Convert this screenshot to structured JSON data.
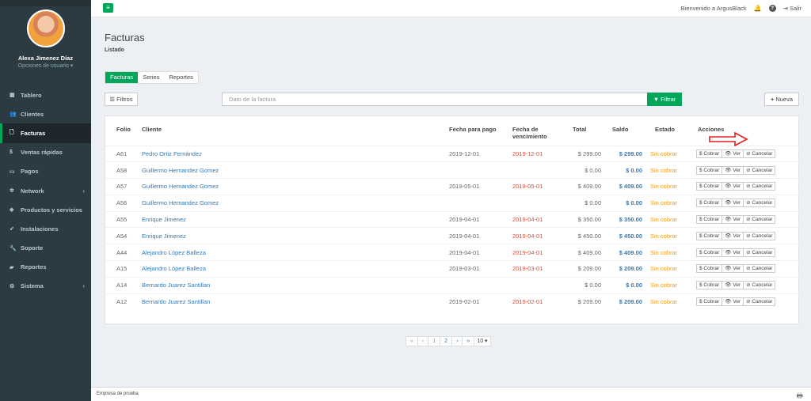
{
  "sidebar": {
    "user_name": "Alexa Jimenez Díaz",
    "user_options": "Opciones de usuario ▾",
    "items": [
      {
        "icon": "dashboard-icon",
        "glyph": "▦",
        "label": "Tablero",
        "active": false
      },
      {
        "icon": "users-icon",
        "glyph": "👥",
        "label": "Clientes",
        "active": false
      },
      {
        "icon": "file-icon",
        "glyph": "🗋",
        "label": "Facturas",
        "active": true
      },
      {
        "icon": "dollar-icon",
        "glyph": "$",
        "label": "Ventas rápidas",
        "active": false
      },
      {
        "icon": "card-icon",
        "glyph": "▭",
        "label": "Pagos",
        "active": false
      },
      {
        "icon": "network-icon",
        "glyph": "✲",
        "label": "Network",
        "active": false,
        "caret": "‹"
      },
      {
        "icon": "tag-icon",
        "glyph": "◈",
        "label": "Productos y servicios",
        "active": false
      },
      {
        "icon": "rocket-icon",
        "glyph": "➶",
        "label": "Instalaciones",
        "active": false
      },
      {
        "icon": "wrench-icon",
        "glyph": "🔧",
        "label": "Soporte",
        "active": false
      },
      {
        "icon": "book-icon",
        "glyph": "▰",
        "label": "Reportes",
        "active": false
      },
      {
        "icon": "cogs-icon",
        "glyph": "⚙",
        "label": "Sistema",
        "active": false,
        "caret": "‹"
      }
    ]
  },
  "topbar": {
    "menu_glyph": "≡",
    "welcome": "Bienvenido a ArgusBlack",
    "bell_glyph": "🔔",
    "help_glyph": "?",
    "logout_label": "Salir"
  },
  "page": {
    "title": "Facturas",
    "subtitle": "Listado"
  },
  "tabs": [
    "Facturas",
    "Series",
    "Reportes"
  ],
  "toolbar": {
    "filters_label": "Filtros",
    "search_placeholder": "Dato de la factura",
    "filter_button": "Filtrar",
    "new_button": "Nueva"
  },
  "table": {
    "headers": {
      "folio": "Folio",
      "client": "Cliente",
      "payment_date": "Fecha para pago",
      "due_date": "Fecha de vencimiento",
      "total": "Total",
      "balance": "Saldo",
      "status": "Estado",
      "actions": "Acciones"
    },
    "action_labels": {
      "charge": "$ Cobrar",
      "view": "👁 Ver",
      "cancel": "⊘ Cancelar"
    },
    "rows": [
      {
        "folio": "A61",
        "client": "Pedro Ortiz Fernández",
        "payment_date": "2019-12-01",
        "due_date": "2019-12-01",
        "total": "$ 299.00",
        "balance": "$ 299.00",
        "status": "Sin cobrar"
      },
      {
        "folio": "A58",
        "client": "Guillermo Hernandez Gomez",
        "payment_date": "",
        "due_date": "",
        "total": "$ 0.00",
        "balance": "$ 0.00",
        "status": "Sin cobrar"
      },
      {
        "folio": "A57",
        "client": "Guillermo Hernandez Gomez",
        "payment_date": "2019-05-01",
        "due_date": "2019-05-01",
        "total": "$ 409.00",
        "balance": "$ 409.00",
        "status": "Sin cobrar"
      },
      {
        "folio": "A56",
        "client": "Guillermo Hernandez Gomez",
        "payment_date": "",
        "due_date": "",
        "total": "$ 0.00",
        "balance": "$ 0.00",
        "status": "Sin cobrar"
      },
      {
        "folio": "A55",
        "client": "Enrique Jimenez",
        "payment_date": "2019-04-01",
        "due_date": "2019-04-01",
        "total": "$ 350.00",
        "balance": "$ 350.00",
        "status": "Sin cobrar"
      },
      {
        "folio": "A54",
        "client": "Enrique Jimenez",
        "payment_date": "2019-04-01",
        "due_date": "2019-04-01",
        "total": "$ 450.00",
        "balance": "$ 450.00",
        "status": "Sin cobrar"
      },
      {
        "folio": "A44",
        "client": "Alejandro López Balleza",
        "payment_date": "2019-04-01",
        "due_date": "2019-04-01",
        "total": "$ 409.00",
        "balance": "$ 409.00",
        "status": "Sin cobrar"
      },
      {
        "folio": "A15",
        "client": "Alejandro López Balleza",
        "payment_date": "2019-03-01",
        "due_date": "2019-03-01",
        "total": "$ 209.00",
        "balance": "$ 209.00",
        "status": "Sin cobrar"
      },
      {
        "folio": "A14",
        "client": "Bernardo Juarez Santillan",
        "payment_date": "",
        "due_date": "",
        "total": "$ 0.00",
        "balance": "$ 0.00",
        "status": "Sin cobrar"
      },
      {
        "folio": "A12",
        "client": "Bernardo Juarez Santillan",
        "payment_date": "2019-02-01",
        "due_date": "2019-02-01",
        "total": "$ 209.00",
        "balance": "$ 209.00",
        "status": "Sin cobrar"
      }
    ]
  },
  "pagination": {
    "first": "«",
    "prev": "‹",
    "pages": [
      "1",
      "2"
    ],
    "next": "›",
    "last": "»",
    "page_size": "10 ▾"
  },
  "footer": {
    "company": "Empresa de prueba",
    "icon_glyph": "🖶"
  },
  "colors": {
    "accent": "#00a65a",
    "sidebar": "#2c3b41",
    "link": "#337ab7",
    "due": "#dd4b39",
    "status": "#f39c12",
    "arrow": "#e02020"
  }
}
